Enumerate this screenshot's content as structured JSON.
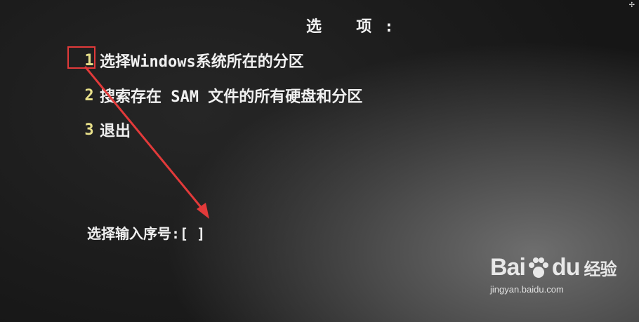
{
  "screen": {
    "title": "选 项:",
    "menu": [
      {
        "number": "1",
        "label": "选择Windows系统所在的分区"
      },
      {
        "number": "2",
        "label": "搜索存在 SAM 文件的所有硬盘和分区"
      },
      {
        "number": "3",
        "label": "退出"
      }
    ],
    "prompt": "选择输入序号:[ ]"
  },
  "annotation": {
    "color": "#e23a3a"
  },
  "watermark": {
    "logo_left": "Bai",
    "logo_right": "du",
    "brand_cn": "经验",
    "url": "jingyan.baidu.com"
  }
}
